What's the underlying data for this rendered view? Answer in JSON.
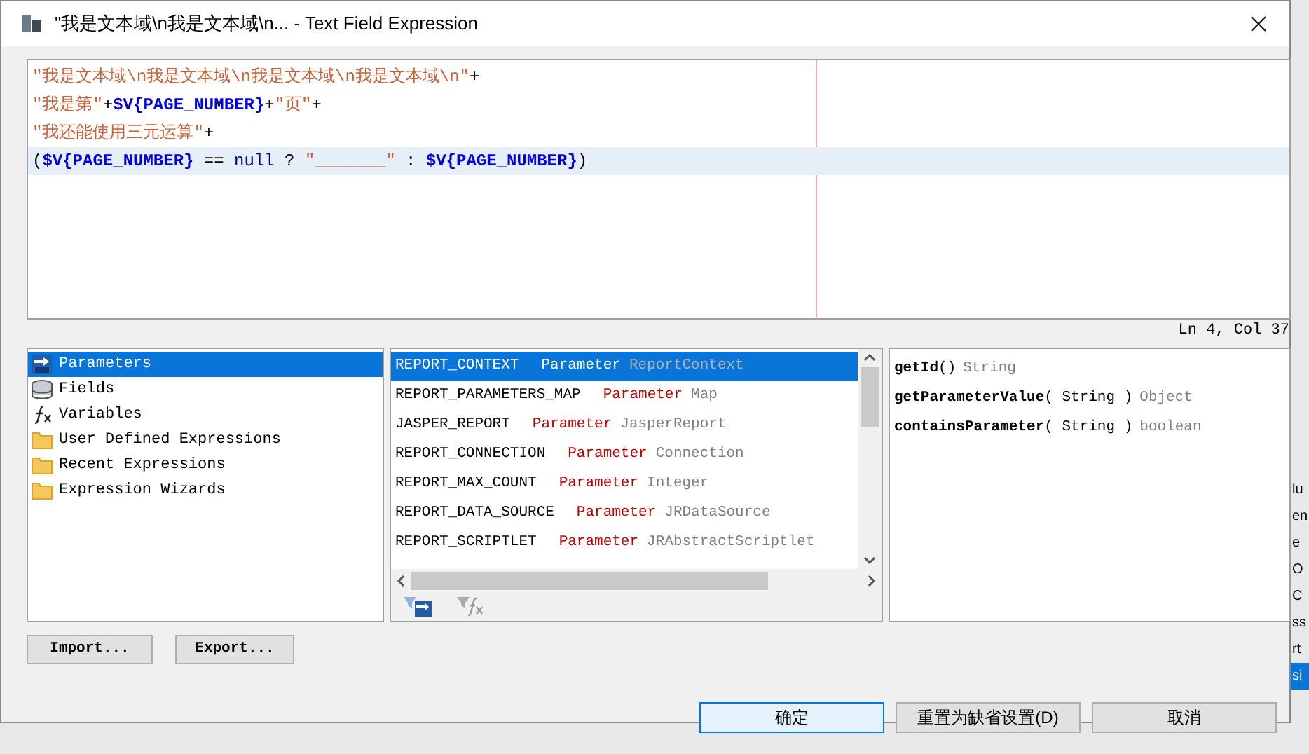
{
  "window": {
    "title": "\"我是文本域\\n我是文本域\\n... - Text Field Expression"
  },
  "editor": {
    "lines": [
      {
        "current": false,
        "tokens": [
          {
            "kind": "string",
            "text": "\"我是文本域\\n我是文本域\\n我是文本域\\n我是文本域\\n\""
          },
          {
            "kind": "op",
            "text": "+"
          }
        ]
      },
      {
        "current": false,
        "tokens": [
          {
            "kind": "string",
            "text": "\"我是第\""
          },
          {
            "kind": "op",
            "text": "+"
          },
          {
            "kind": "var",
            "text": "$V{PAGE_NUMBER}"
          },
          {
            "kind": "op",
            "text": "+"
          },
          {
            "kind": "string",
            "text": "\"页\""
          },
          {
            "kind": "op",
            "text": "+"
          }
        ]
      },
      {
        "current": false,
        "tokens": [
          {
            "kind": "string",
            "text": "\"我还能使用三元运算\""
          },
          {
            "kind": "op",
            "text": "+"
          }
        ]
      },
      {
        "current": true,
        "tokens": [
          {
            "kind": "op",
            "text": "("
          },
          {
            "kind": "var",
            "text": "$V{PAGE_NUMBER}"
          },
          {
            "kind": "op",
            "text": " == "
          },
          {
            "kind": "keyword",
            "text": "null"
          },
          {
            "kind": "op",
            "text": " ? "
          },
          {
            "kind": "string",
            "text": "\"_______\""
          },
          {
            "kind": "op",
            "text": " : "
          },
          {
            "kind": "var",
            "text": "$V{PAGE_NUMBER}"
          },
          {
            "kind": "op",
            "text": ")"
          }
        ]
      }
    ],
    "caret_position": "Ln 4, Col 37"
  },
  "categories": [
    {
      "kind": "parameters",
      "label": "Parameters",
      "selected": true
    },
    {
      "kind": "fields",
      "label": "Fields",
      "selected": false
    },
    {
      "kind": "variables",
      "label": "Variables",
      "selected": false
    },
    {
      "kind": "folder",
      "label": "User Defined Expressions",
      "selected": false
    },
    {
      "kind": "folder",
      "label": "Recent Expressions",
      "selected": false
    },
    {
      "kind": "folder",
      "label": "Expression Wizards",
      "selected": false
    }
  ],
  "objects": [
    {
      "name": "REPORT_CONTEXT",
      "kind": "Parameter",
      "type": "ReportContext",
      "selected": true
    },
    {
      "name": "REPORT_PARAMETERS_MAP",
      "kind": "Parameter",
      "type": "Map",
      "selected": false
    },
    {
      "name": "JASPER_REPORT",
      "kind": "Parameter",
      "type": "JasperReport",
      "selected": false
    },
    {
      "name": "REPORT_CONNECTION",
      "kind": "Parameter",
      "type": "Connection",
      "selected": false
    },
    {
      "name": "REPORT_MAX_COUNT",
      "kind": "Parameter",
      "type": "Integer",
      "selected": false
    },
    {
      "name": "REPORT_DATA_SOURCE",
      "kind": "Parameter",
      "type": "JRDataSource",
      "selected": false
    },
    {
      "name": "REPORT_SCRIPTLET",
      "kind": "Parameter",
      "type": "JRAbstractScriptlet",
      "selected": false
    }
  ],
  "methods": [
    {
      "name": "getId",
      "args": "()",
      "returns": "String"
    },
    {
      "name": "getParameterValue",
      "args": "( String )",
      "returns": "Object"
    },
    {
      "name": "containsParameter",
      "args": "( String )",
      "returns": "boolean"
    }
  ],
  "import_button": "Import...",
  "export_button": "Export...",
  "buttons": [
    {
      "label": "确定",
      "default": true
    },
    {
      "label": "重置为缺省设置(D)",
      "default": false
    },
    {
      "label": "取消",
      "default": false
    }
  ],
  "background_window": {
    "fragments": [
      {
        "text": "lu",
        "selected": false
      },
      {
        "text": "en",
        "selected": false
      },
      {
        "text": "e",
        "selected": false
      },
      {
        "text": "O",
        "selected": false
      },
      {
        "text": "C",
        "selected": false
      },
      {
        "text": "ss",
        "selected": false
      },
      {
        "text": "rt",
        "selected": false
      },
      {
        "text": "si",
        "selected": true
      }
    ]
  }
}
